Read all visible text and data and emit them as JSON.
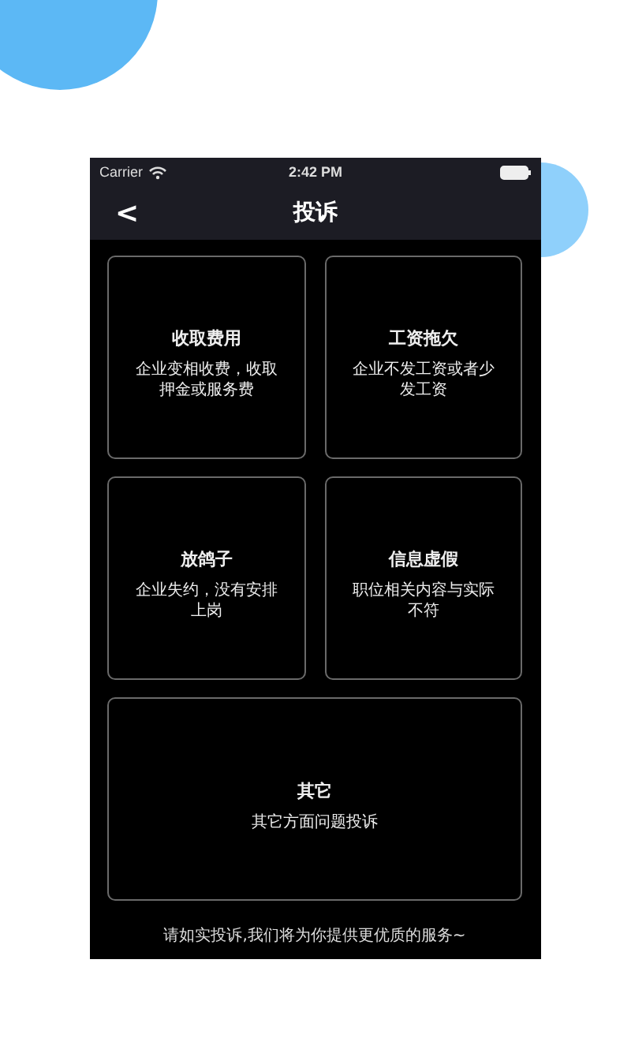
{
  "status_bar": {
    "carrier": "Carrier",
    "time": "2:42 PM"
  },
  "nav_bar": {
    "back": "<",
    "title": "投诉"
  },
  "categories": [
    {
      "title": "收取费用",
      "description": "企业变相收费，收取押金或服务费"
    },
    {
      "title": "工资拖欠",
      "description": "企业不发工资或者少发工资"
    },
    {
      "title": "放鸽子",
      "description": "企业失约，没有安排上岗"
    },
    {
      "title": "信息虚假",
      "description": "职位相关内容与实际不符"
    },
    {
      "title": "其它",
      "description": "其它方面问题投诉"
    }
  ],
  "footer": "请如实投诉,我们将为你提供更优质的服务~"
}
